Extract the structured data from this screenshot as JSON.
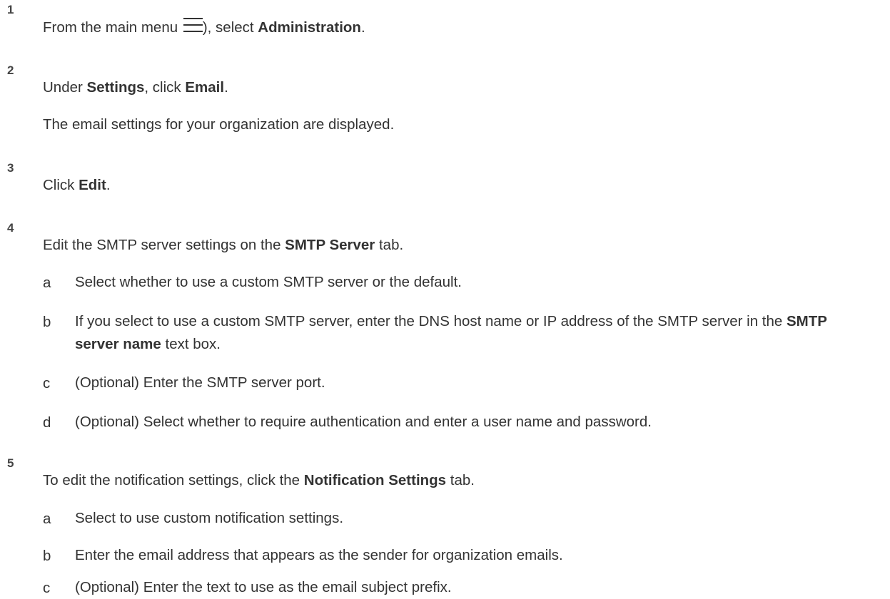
{
  "steps": [
    {
      "num": "1",
      "text_before": "From the main menu ",
      "icon": "hamburger-menu-icon",
      "text_after_icon": "), select ",
      "bold": "Administration",
      "text_end": "."
    },
    {
      "num": "2",
      "pre": "Under ",
      "bold1": "Settings",
      "mid": ", click ",
      "bold2": "Email",
      "end": ".",
      "note": "The email settings for your organization are displayed."
    },
    {
      "num": "3",
      "pre": "Click ",
      "bold": "Edit",
      "end": "."
    },
    {
      "num": "4",
      "pre": "Edit the SMTP server settings on the ",
      "bold": "SMTP Server",
      "end": " tab.",
      "substeps": [
        {
          "letter": "a",
          "text": "Select whether to use a custom SMTP server or the default."
        },
        {
          "letter": "b",
          "pre": "If you select to use a custom SMTP server, enter the DNS host name or IP address of the SMTP server in the ",
          "bold": "SMTP server name",
          "end": " text box."
        },
        {
          "letter": "c",
          "text": "(Optional) Enter the SMTP server port."
        },
        {
          "letter": "d",
          "text": "(Optional) Select whether to require authentication and enter a user name and password."
        }
      ]
    },
    {
      "num": "5",
      "pre": "To edit the notification settings, click the ",
      "bold": "Notification Settings",
      "end": " tab.",
      "substeps": [
        {
          "letter": "a",
          "text": "Select to use custom notification settings."
        },
        {
          "letter": "b",
          "text": "Enter the email address that appears as the sender for organization emails."
        },
        {
          "letter": "c",
          "text": "(Optional) Enter the text to use as the email subject prefix."
        }
      ]
    }
  ]
}
